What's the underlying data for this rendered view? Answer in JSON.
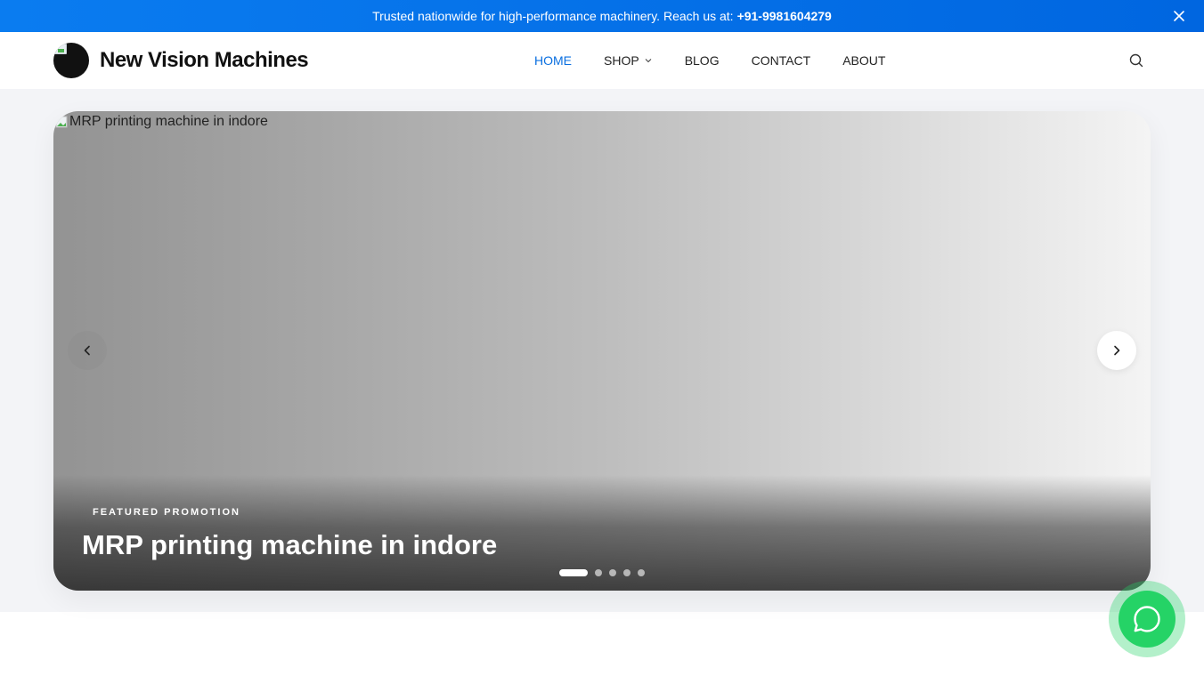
{
  "topbar": {
    "message": "Trusted nationwide for high-performance machinery. Reach us at:",
    "phone": "+91-9981604279"
  },
  "header": {
    "brand": "New Vision Machines",
    "nav": [
      {
        "label": "HOME",
        "active": true
      },
      {
        "label": "SHOP",
        "has_dropdown": true
      },
      {
        "label": "BLOG"
      },
      {
        "label": "CONTACT"
      },
      {
        "label": "ABOUT"
      }
    ]
  },
  "hero": {
    "image_alt": "MRP printing machine in indore",
    "tag": "FEATURED PROMOTION",
    "title": "MRP printing machine in indore",
    "slide_count": 5,
    "active_slide": 1
  },
  "slider_progress": 0.2,
  "icons": {
    "close": "close-icon",
    "search": "search-icon",
    "prev": "chevron-left-icon",
    "next": "chevron-right-icon",
    "dropdown": "chevron-down-icon",
    "chat": "whatsapp-icon"
  },
  "colors": {
    "accent": "#0a6fe0",
    "whatsapp": "#25d366"
  }
}
